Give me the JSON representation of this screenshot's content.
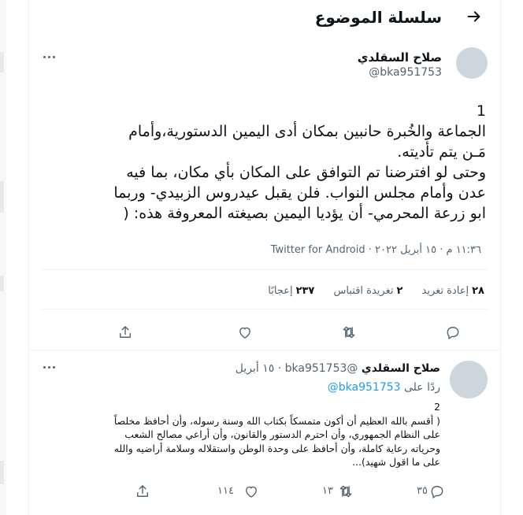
{
  "header": {
    "title": "سلسلة الموضوع",
    "back_icon": "arrow-right-icon"
  },
  "tweet": {
    "author_name": "صلاح السقلدي",
    "handle": "@bka951753",
    "body_lines": [
      "1",
      "الجماعة والخُبرة حانبين بمكان  أدى اليمين الدستورية،وأمام",
      "مَـن يتم تأديته.",
      " وحتى لو افترضنا تم التوافق على المكان بأي مكان، بما فيه",
      "عدن وأمام مجلس النواب. فلن يقبل عيدروس الزبيدي- وربما",
      "ابو زرعة المحرمي- أن يؤديا اليمين بصيغته المعروفة هذه:  ("
    ],
    "time": "١١:٣٦ م",
    "date": "١٥ أبريل ٢٠٢٢",
    "app": "Twitter for Android",
    "stats": {
      "retweets_count": "٢٨",
      "retweets_label": "إعادة تغريد",
      "quotes_count": "٢",
      "quotes_label": "تغريدة اقتباس",
      "likes_count": "٢٣٧",
      "likes_label": "إعجابًا"
    }
  },
  "reply": {
    "author_name": "صلاح السقلدي",
    "handle": "@bka951753",
    "date": "١٥ أبريل",
    "replying_label": "ردًا على",
    "replying_to": "@bka951753",
    "body_lines": [
      "2",
      "( أقسم بالله العظيم أن أكون متمسكاً بكتاب الله وسنة رسوله، وأن أحافظ مخلصاً",
      "على النظام الجمهوري، وأن احترم الدستور والقانون، وأن أراعي مصالح الشعب",
      "وحرياته رعاية كاملة، وأن أحافظ على وحدة الوطن واستقلاله وسلامة أراضيه والله",
      "على ما اقول شهيد)..."
    ],
    "replies_count": "٣٥",
    "retweets_count": "١٣",
    "likes_count": "١١٤"
  }
}
